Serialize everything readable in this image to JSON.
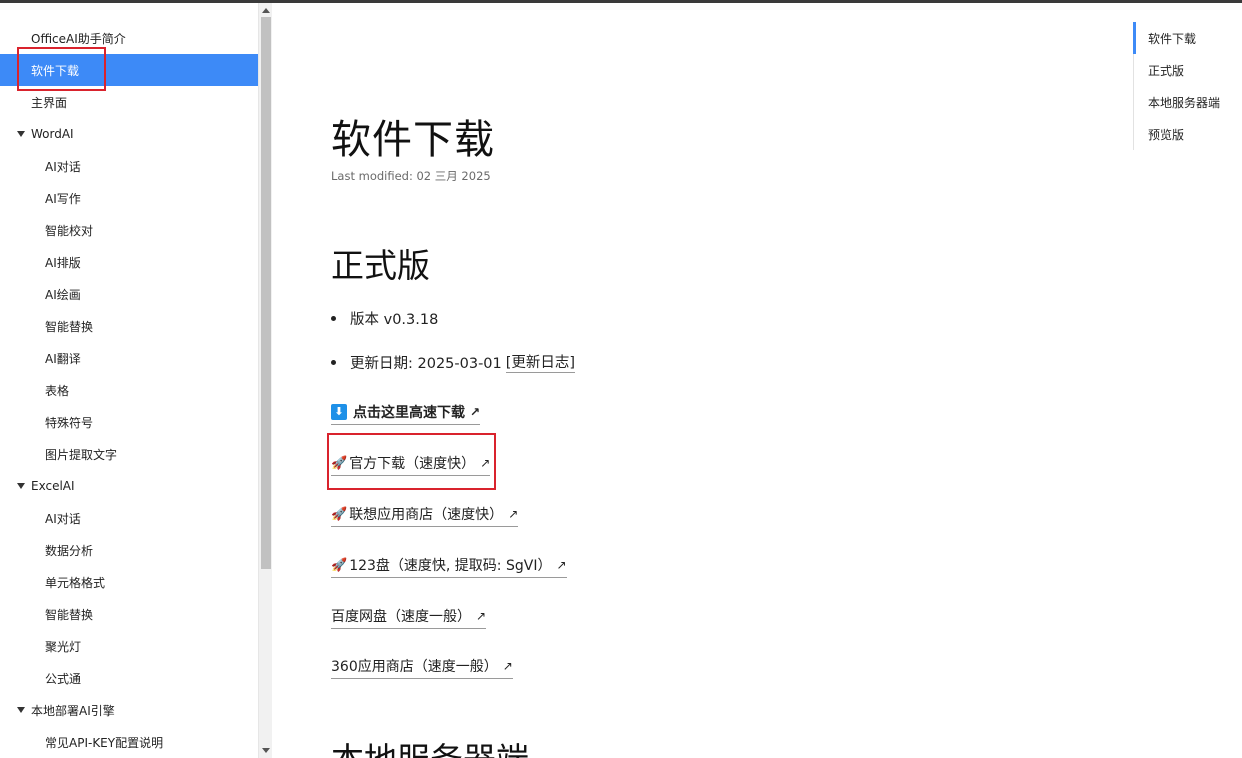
{
  "sidebar": {
    "items": [
      {
        "label": "OfficeAI助手简介"
      },
      {
        "label": "软件下载"
      },
      {
        "label": "主界面"
      },
      {
        "label": "WordAI"
      },
      {
        "label": "AI对话"
      },
      {
        "label": "AI写作"
      },
      {
        "label": "智能校对"
      },
      {
        "label": "AI排版"
      },
      {
        "label": "AI绘画"
      },
      {
        "label": "智能替换"
      },
      {
        "label": "AI翻译"
      },
      {
        "label": "表格"
      },
      {
        "label": "特殊符号"
      },
      {
        "label": "图片提取文字"
      },
      {
        "label": "ExcelAI"
      },
      {
        "label": "AI对话"
      },
      {
        "label": "数据分析"
      },
      {
        "label": "单元格格式"
      },
      {
        "label": "智能替换"
      },
      {
        "label": "聚光灯"
      },
      {
        "label": "公式通"
      },
      {
        "label": "本地部署AI引擎"
      },
      {
        "label": "常见API-KEY配置说明"
      }
    ]
  },
  "main": {
    "title": "软件下载",
    "last_modified": "Last modified: 02 三月 2025",
    "section_official": "正式版",
    "version": "版本 v0.3.18",
    "update_date_prefix": "更新日期: 2025-03-01 ",
    "changelog": "[更新日志]",
    "links": {
      "fast_download": "点击这里高速下载",
      "official": "官方下载（速度快）",
      "lenovo": "联想应用商店（速度快）",
      "pan123": "123盘（速度快, 提取码: SgVI）",
      "baidu": "百度网盘（速度一般）",
      "store360": "360应用商店（速度一般）"
    },
    "ext_arrow": "↗",
    "rocket": "🚀",
    "download_glyph": "⬇",
    "section_local": "本地服务器端"
  },
  "toc": {
    "items": [
      "软件下载",
      "正式版",
      "本地服务器端",
      "预览版"
    ]
  },
  "colors": {
    "accent": "#3d8af7",
    "highlight": "#d9232d"
  }
}
